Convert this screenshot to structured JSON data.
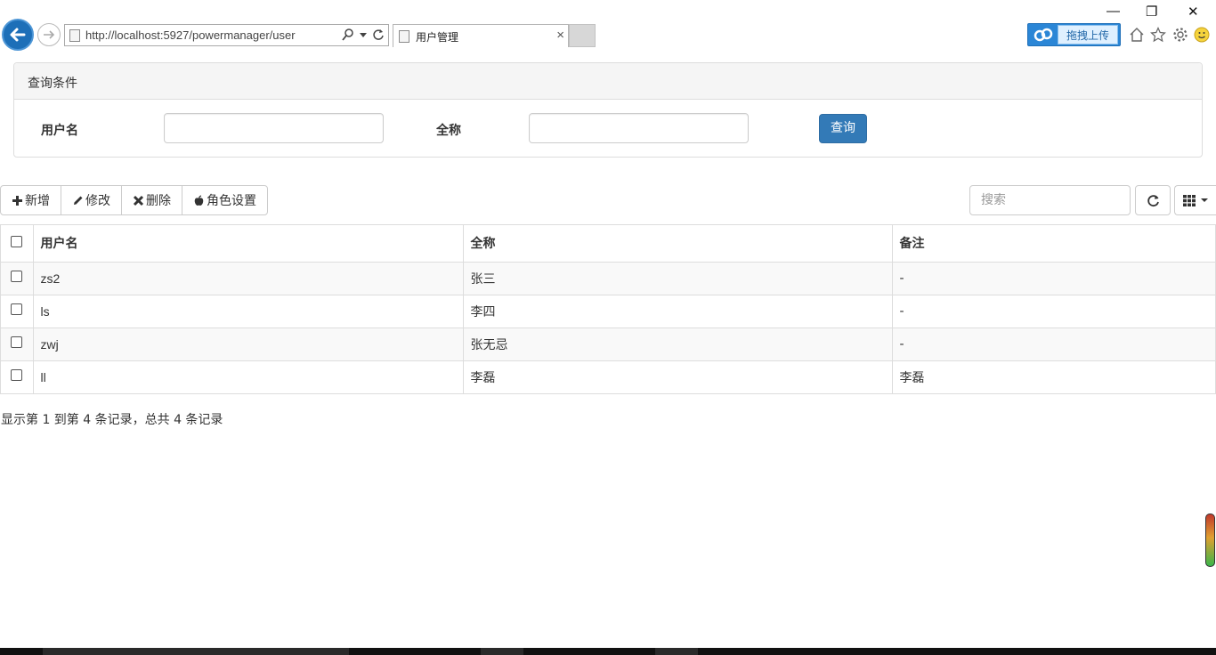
{
  "browser": {
    "url": "http://localhost:5927/powermanager/user",
    "tab_title": "用户管理",
    "tab_close": "×",
    "upload_label": "拖拽上传",
    "minimize": "—",
    "restore": "❐",
    "close": "✕"
  },
  "query_panel": {
    "heading": "查询条件",
    "username_label": "用户名",
    "username_value": "",
    "fullname_label": "全称",
    "fullname_value": "",
    "query_button": "查询"
  },
  "toolbar": {
    "add": "新增",
    "edit": "修改",
    "delete": "删除",
    "role": "角色设置",
    "search_placeholder": "搜索"
  },
  "table": {
    "columns": [
      "用户名",
      "全称",
      "备注"
    ],
    "rows": [
      {
        "username": "zs2",
        "fullname": "张三",
        "remark": "-"
      },
      {
        "username": "ls",
        "fullname": "李四",
        "remark": "-"
      },
      {
        "username": "zwj",
        "fullname": "张无忌",
        "remark": "-"
      },
      {
        "username": "ll",
        "fullname": "李磊",
        "remark": "李磊"
      }
    ]
  },
  "pagination": {
    "info": "显示第 1 到第 4 条记录，总共 4 条记录"
  },
  "colors": {
    "primary": "#337ab7",
    "browser_back": "#1d6fb8",
    "upload_blue": "#2b86d6"
  }
}
